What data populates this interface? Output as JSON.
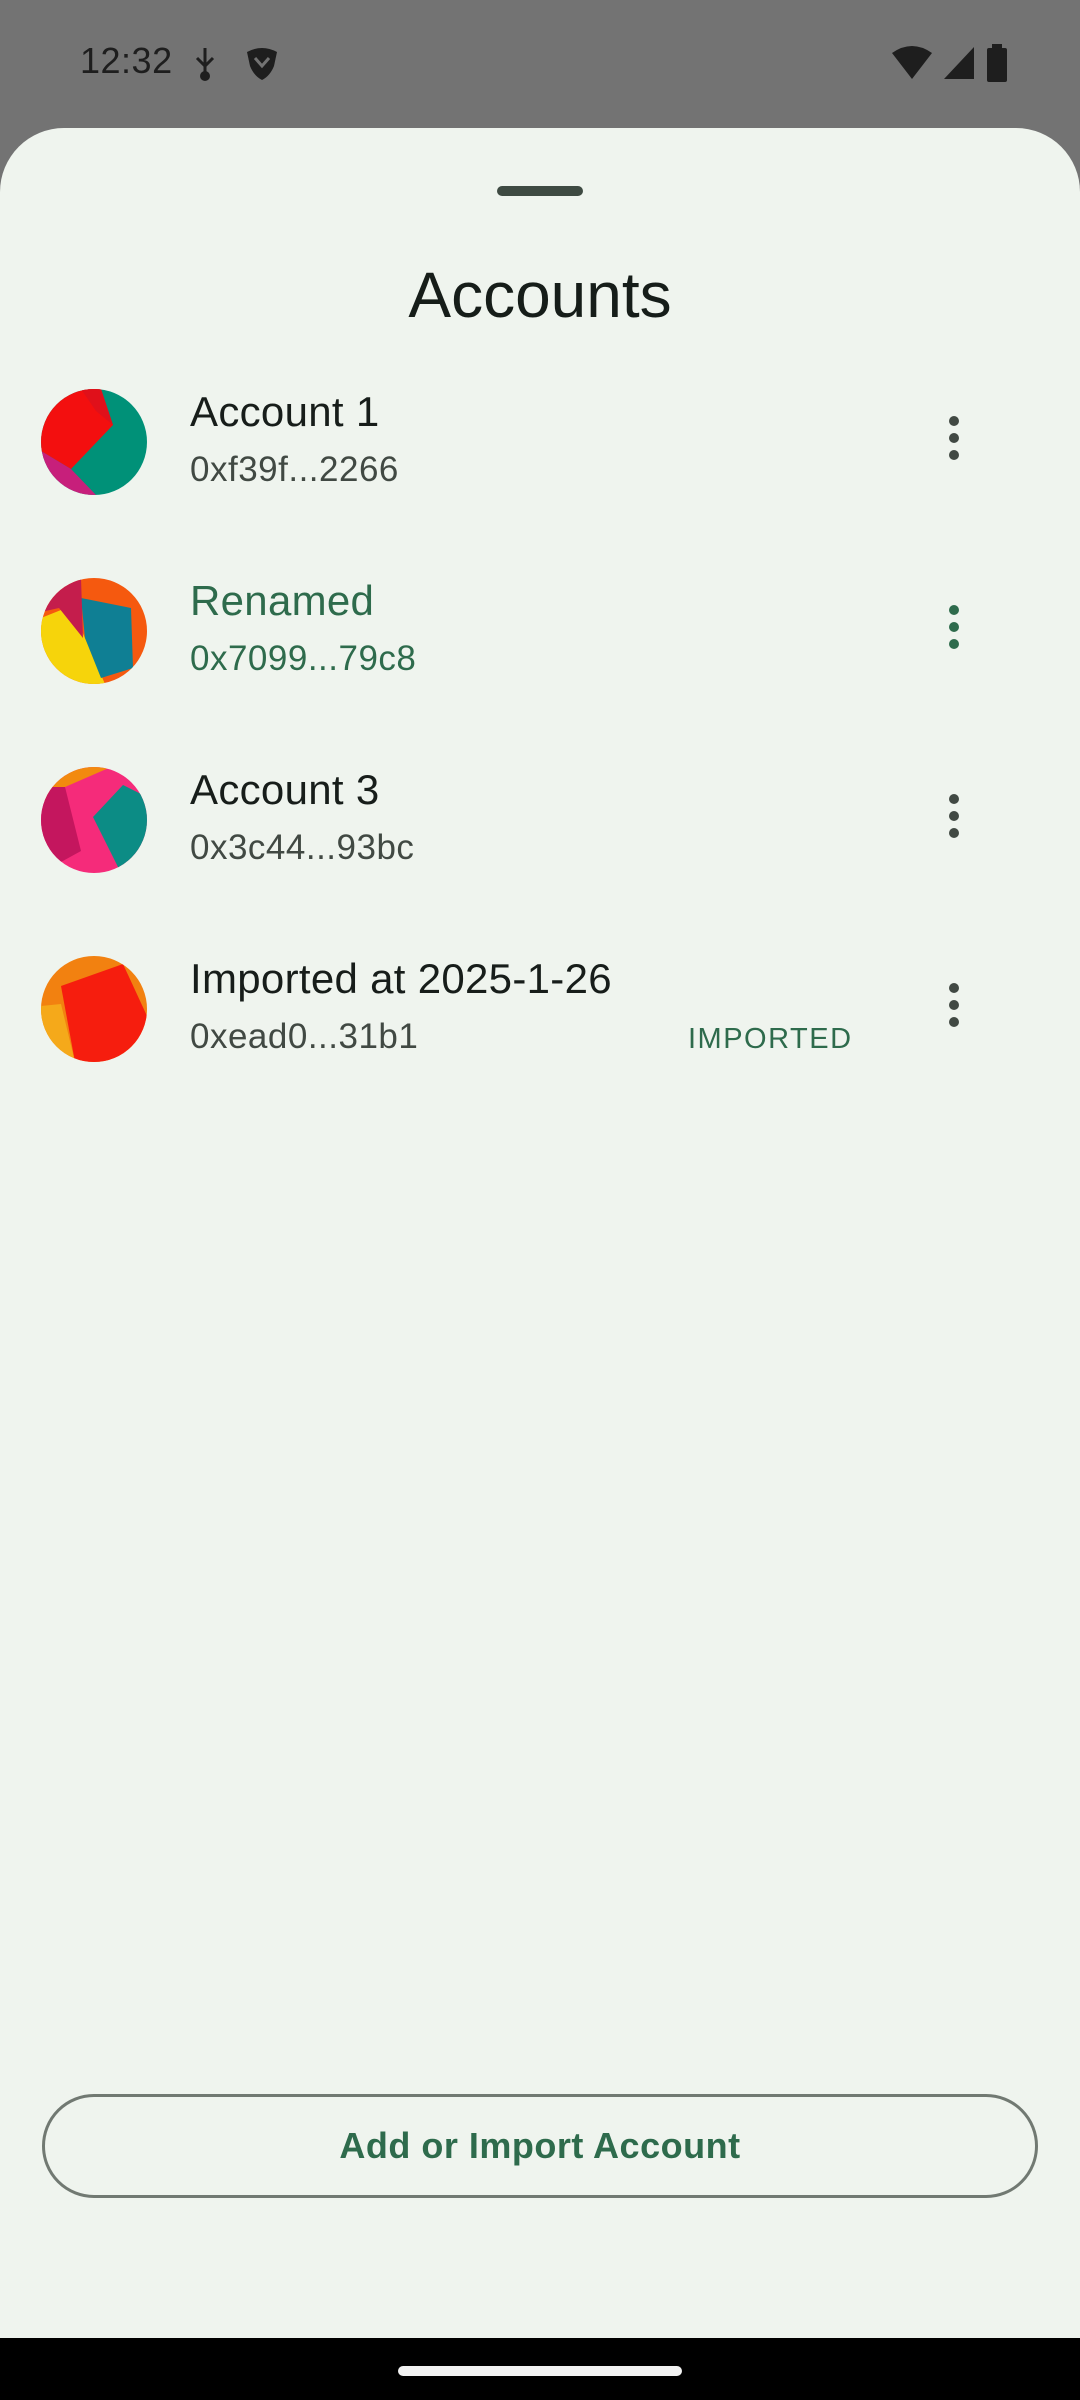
{
  "status_bar": {
    "time": "12:32",
    "icons_left": [
      "usb-debug-icon",
      "shield-icon"
    ],
    "icons_right": [
      "wifi-icon",
      "signal-icon",
      "battery-icon"
    ]
  },
  "sheet": {
    "title": "Accounts"
  },
  "accounts": [
    {
      "name": "Account 1",
      "address": "0xf39f...2266",
      "badge": "",
      "selected": false
    },
    {
      "name": "Renamed",
      "address": "0x7099...79c8",
      "badge": "",
      "selected": true
    },
    {
      "name": "Account 3",
      "address": "0x3c44...93bc",
      "badge": "",
      "selected": false
    },
    {
      "name": "Imported at 2025-1-26",
      "address": "0xead0...31b1",
      "badge": "IMPORTED",
      "selected": false
    }
  ],
  "actions": {
    "add_import_label": "Add or Import Account"
  },
  "colors": {
    "accent": "#2e6b4c",
    "sheet_bg": "#eff4ee",
    "scrim": "#737373"
  }
}
